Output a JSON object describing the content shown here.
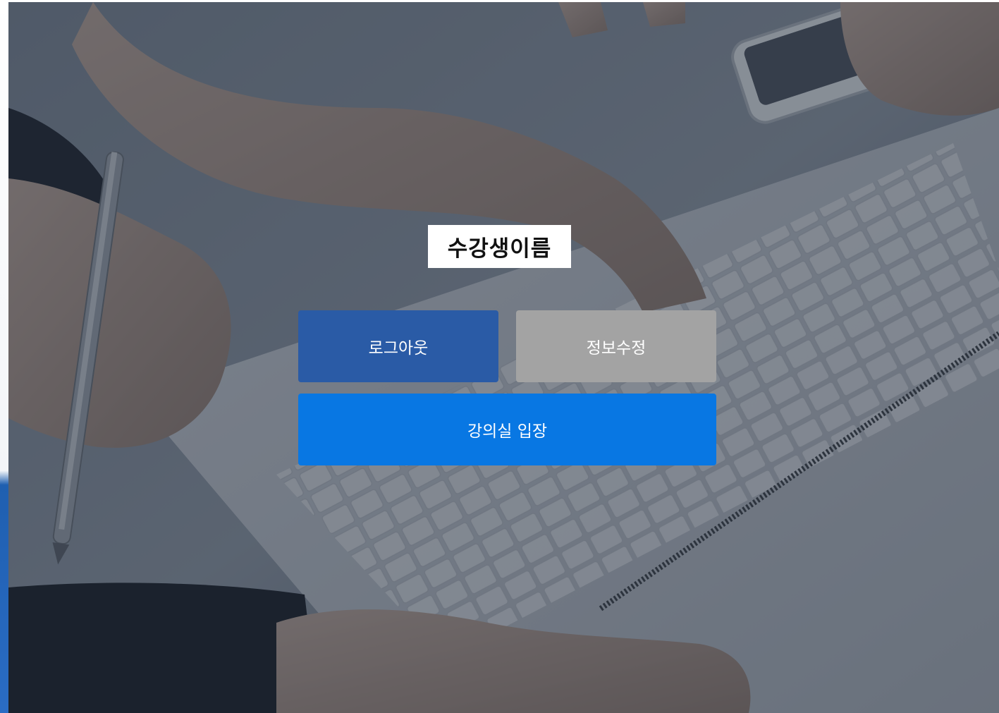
{
  "student": {
    "name": "수강생이름"
  },
  "actions": {
    "logout_label": "로그아웃",
    "edit_info_label": "정보수정",
    "enter_classroom_label": "강의실 입장"
  },
  "colors": {
    "logout_button": "#2a5ba6",
    "edit_info_button": "#a3a3a3",
    "enter_classroom_button": "#0877e3",
    "name_box": "#ffffff"
  }
}
